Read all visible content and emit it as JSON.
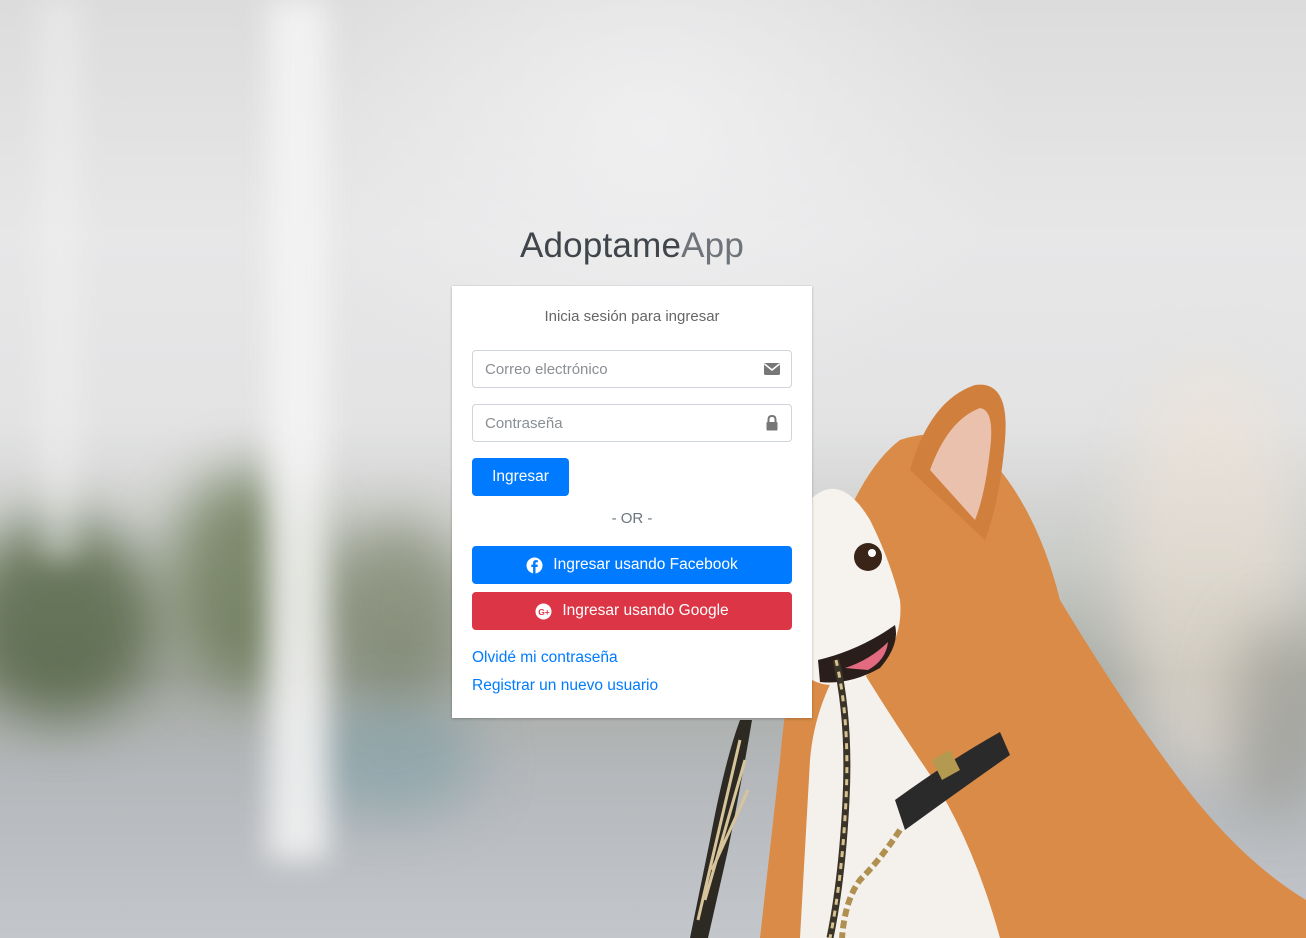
{
  "brand": {
    "bold": "Adoptame",
    "light": "App"
  },
  "card": {
    "message": "Inicia sesión para ingresar",
    "email_placeholder": "Correo electrónico",
    "password_placeholder": "Contraseña",
    "submit_label": "Ingresar",
    "divider": "- OR -",
    "facebook_label": "Ingresar usando Facebook",
    "google_label": "Ingresar usando Google",
    "forgot_link": "Olvidé mi contraseña",
    "register_link": "Registrar un nuevo usuario"
  },
  "icons": {
    "email": "envelope-icon",
    "password": "lock-icon",
    "facebook": "facebook-icon",
    "google": "google-plus-icon"
  },
  "colors": {
    "primary": "#007bff",
    "danger": "#dc3545",
    "link": "#007bff"
  }
}
